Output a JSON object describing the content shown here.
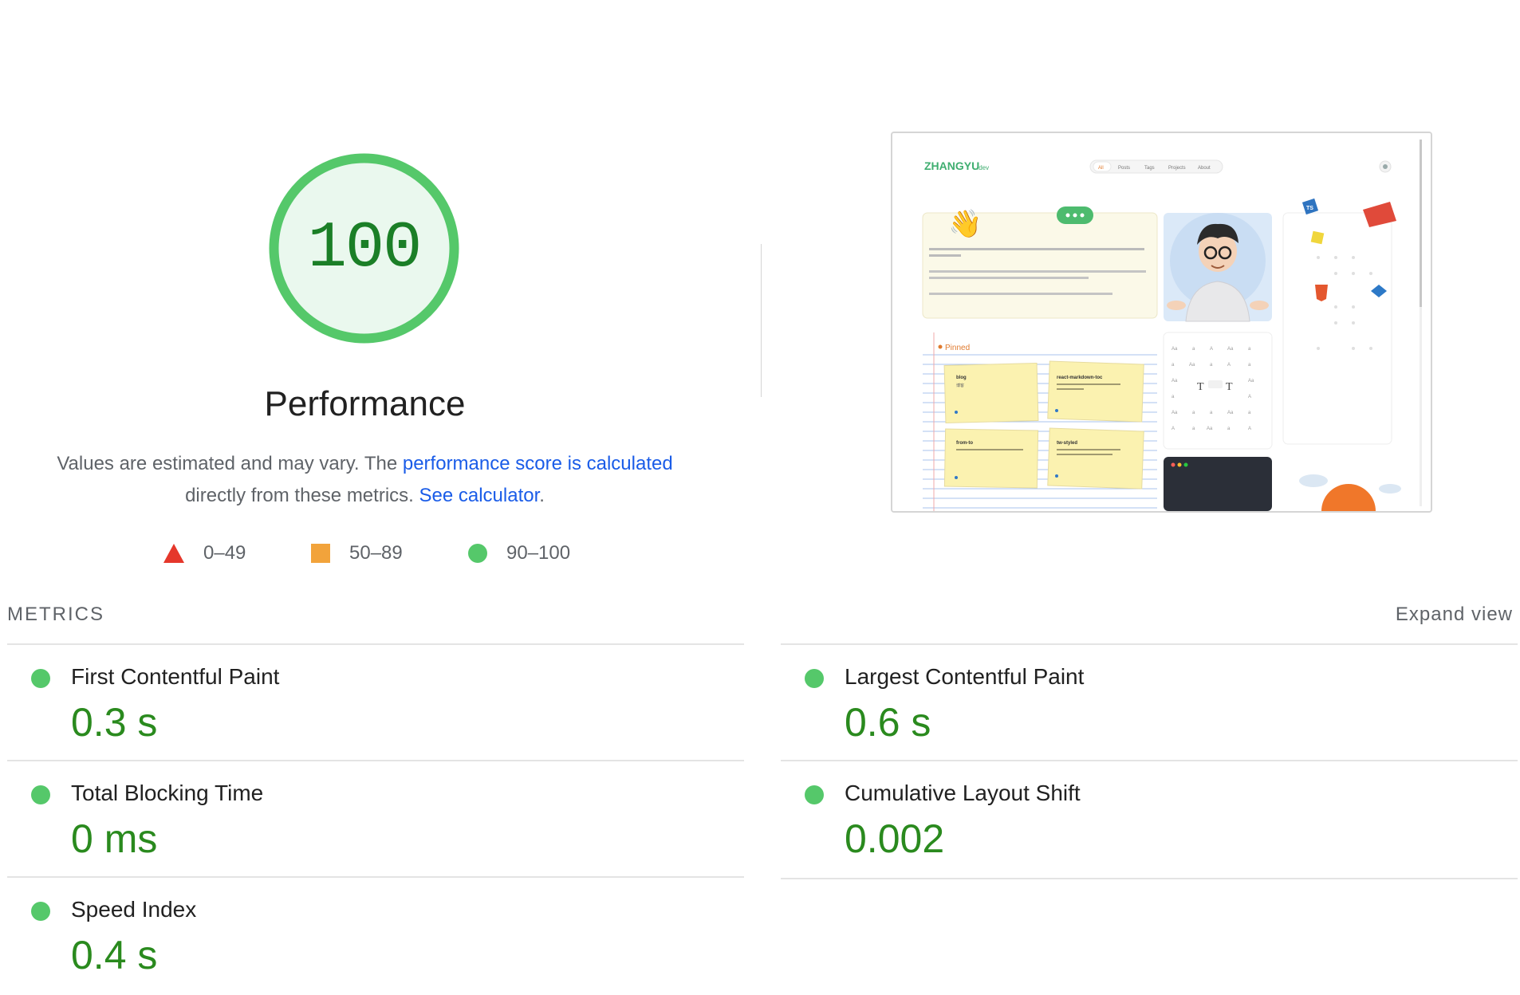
{
  "gauge": {
    "score": "100",
    "score_fraction": 1.0,
    "title": "Performance",
    "desc_text1": "Values are estimated and may vary. The ",
    "desc_link1": "performance score is calculated",
    "desc_text2": " directly from these metrics. ",
    "desc_link2": "See calculator",
    "desc_text3": ".",
    "colors": {
      "ring": "#55c86a",
      "fill": "#eaf8ee",
      "score_text": "#1b7f27"
    }
  },
  "legend": {
    "fail": {
      "label": "0–49",
      "color": "#e5372b"
    },
    "average": {
      "label": "50–89",
      "color": "#f2a33b"
    },
    "pass": {
      "label": "90–100",
      "color": "#55c86a"
    }
  },
  "thumbnail": {
    "logo": "ZHANGYU",
    "logo_suffix": ".dev",
    "nav": [
      "All",
      "Posts",
      "Tags",
      "Projects",
      "About"
    ],
    "pinned_label": "Pinned",
    "cards": [
      {
        "title": "blog",
        "sub": "博客"
      },
      {
        "title": "react-markdown-toc",
        "sub": "Generating a Table of Contents (TOC) from Markdown"
      },
      {
        "title": "from-to",
        "sub": "Transforming from one value to another"
      },
      {
        "title": "tw-styled",
        "sub": "Create Tailwind CSS styled React components with easy variants"
      }
    ]
  },
  "metrics": {
    "title": "METRICS",
    "expand_label": "Expand view",
    "items": [
      {
        "name": "First Contentful Paint",
        "value": "0.3 s"
      },
      {
        "name": "Largest Contentful Paint",
        "value": "0.6 s"
      },
      {
        "name": "Total Blocking Time",
        "value": "0 ms"
      },
      {
        "name": "Cumulative Layout Shift",
        "value": "0.002"
      },
      {
        "name": "Speed Index",
        "value": "0.4 s"
      }
    ],
    "pass_color": "#55c86a",
    "value_color": "#2a8a1e"
  }
}
